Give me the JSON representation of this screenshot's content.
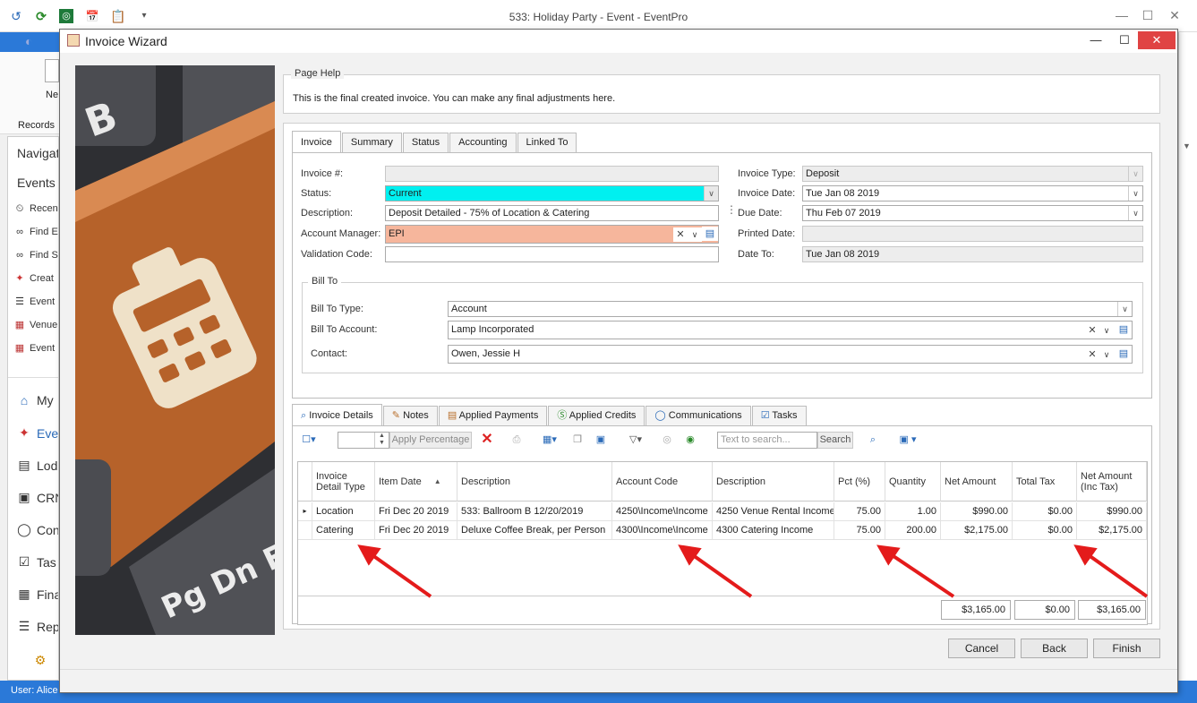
{
  "main_window": {
    "title": "533: Holiday Party - Event - EventPro",
    "ribbon": {
      "new_label": "Ne",
      "records_label": "Records"
    },
    "nav": {
      "header": "Navigat",
      "events_header": "Events",
      "items": [
        "Recen",
        "Find E",
        "Find S",
        "Creat",
        "Event",
        "Venue",
        "Event"
      ],
      "modules": [
        "My",
        "Eve",
        "Lod",
        "CRN",
        "Con",
        "Tas",
        "Fina",
        "Rep"
      ]
    },
    "status_user": "User: Alice"
  },
  "wizard": {
    "title": "Invoice Wizard",
    "page_help": {
      "legend": "Page Help",
      "text": "This is the final created invoice.  You can make any final adjustments here."
    },
    "tabs": [
      "Invoice",
      "Summary",
      "Status",
      "Accounting",
      "Linked To"
    ],
    "invoice": {
      "invoice_no_label": "Invoice #:",
      "invoice_no": "",
      "status_label": "Status:",
      "status": "Current",
      "description_label": "Description:",
      "description": "Deposit Detailed - 75% of Location & Catering",
      "account_manager_label": "Account Manager:",
      "account_manager": "EPI",
      "validation_code_label": "Validation Code:",
      "validation_code": "",
      "invoice_type_label": "Invoice Type:",
      "invoice_type": "Deposit",
      "invoice_date_label": "Invoice Date:",
      "invoice_date": "Tue Jan 08 2019",
      "due_date_label": "Due Date:",
      "due_date": "Thu Feb 07 2019",
      "printed_date_label": "Printed Date:",
      "printed_date": "",
      "date_to_label": "Date To:",
      "date_to": "Tue Jan 08 2019"
    },
    "bill_to": {
      "legend": "Bill To",
      "type_label": "Bill To Type:",
      "type": "Account",
      "account_label": "Bill To Account:",
      "account": "Lamp Incorporated",
      "contact_label": "Contact:",
      "contact": "Owen, Jessie H"
    },
    "detail_tabs": [
      "Invoice Details",
      "Notes",
      "Applied Payments",
      "Applied Credits",
      "Communications",
      "Tasks"
    ],
    "toolbar": {
      "apply_percentage": "Apply Percentage",
      "search_placeholder": "Text to search...",
      "search_button": "Search"
    },
    "grid": {
      "columns": [
        "Invoice Detail Type",
        "Item Date",
        "Description",
        "Account Code",
        "Description",
        "Pct (%)",
        "Quantity",
        "Net Amount",
        "Total Tax",
        "Net Amount (Inc Tax)"
      ],
      "rows": [
        [
          "Location",
          "Fri Dec 20 2019",
          "533: Ballroom B 12/20/2019",
          "4250\\Income\\Income",
          "4250 Venue Rental Income",
          "75.00",
          "1.00",
          "$990.00",
          "$0.00",
          "$990.00"
        ],
        [
          "Catering",
          "Fri Dec 20 2019",
          "Deluxe Coffee Break, per Person",
          "4300\\Income\\Income",
          "4300 Catering Income",
          "75.00",
          "200.00",
          "$2,175.00",
          "$0.00",
          "$2,175.00"
        ]
      ],
      "totals": {
        "net_amount": "$3,165.00",
        "total_tax": "$0.00",
        "net_inc_tax": "$3,165.00"
      }
    },
    "buttons": {
      "cancel": "Cancel",
      "back": "Back",
      "finish": "Finish"
    }
  },
  "colors": {
    "status_highlight": "#00f0f0",
    "account_manager_highlight": "#f6b69c",
    "annotation_arrow": "#e41b1b",
    "accent_blue": "#2b79d8",
    "close_button": "#e04343"
  },
  "icons": [
    "back-icon",
    "refresh-icon",
    "target-icon",
    "calendar-icon",
    "clipboard-icon",
    "calculator-icon",
    "search-icon",
    "notes-icon",
    "payments-icon",
    "credits-icon",
    "communications-icon",
    "tasks-icon",
    "delete-icon",
    "filter-icon",
    "save-icon"
  ]
}
